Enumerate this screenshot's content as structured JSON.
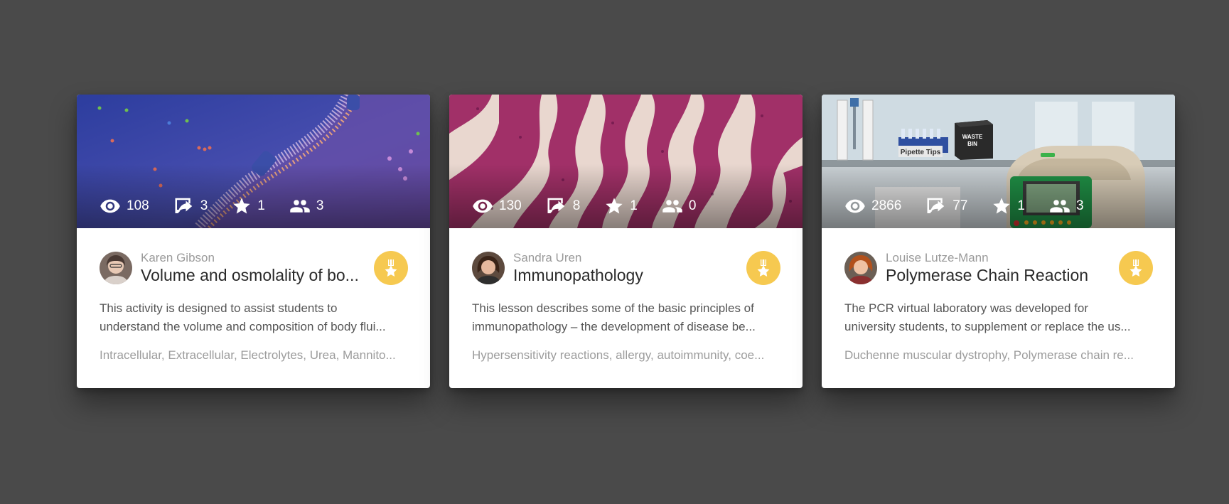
{
  "cards": [
    {
      "stats": {
        "views": "108",
        "shares": "3",
        "stars": "1",
        "users": "3"
      },
      "author": "Karen Gibson",
      "title": "Volume and osmolality of bo...",
      "description_lines": [
        "This activity is designed to assist students to",
        "understand the volume and composition of body flui..."
      ],
      "tags": "Intracellular, Extracellular, Electrolytes, Urea, Mannito...",
      "icons": {
        "views": "eye-icon",
        "shares": "share-icon",
        "stars": "star-icon",
        "users": "people-icon",
        "badge": "award-ribbon-icon"
      }
    },
    {
      "stats": {
        "views": "130",
        "shares": "8",
        "stars": "1",
        "users": "0"
      },
      "author": "Sandra Uren",
      "title": "Immunopathology",
      "description_lines": [
        "This lesson describes some of the basic principles of",
        "immunopathology – the development of disease be..."
      ],
      "tags": "Hypersensitivity reactions, allergy, autoimmunity, coe...",
      "icons": {
        "views": "eye-icon",
        "shares": "share-icon",
        "stars": "star-icon",
        "users": "people-icon",
        "badge": "award-ribbon-icon"
      }
    },
    {
      "stats": {
        "views": "2866",
        "shares": "77",
        "stars": "1",
        "users": "3"
      },
      "author": "Louise Lutze-Mann",
      "title": "Polymerase Chain Reaction",
      "description_lines": [
        "The PCR virtual laboratory was developed for",
        "university students, to supplement or replace the us..."
      ],
      "tags": "Duchenne muscular dystrophy, Polymerase chain re...",
      "thumbnail_labels": {
        "tips": "Pipette Tips",
        "bin_line1": "WASTE",
        "bin_line2": "BIN"
      },
      "icons": {
        "views": "eye-icon",
        "shares": "share-icon",
        "stars": "star-icon",
        "users": "people-icon",
        "badge": "award-ribbon-icon"
      }
    }
  ],
  "colors": {
    "background": "#4a4a4a",
    "badge": "#f6c950",
    "card": "#ffffff"
  }
}
